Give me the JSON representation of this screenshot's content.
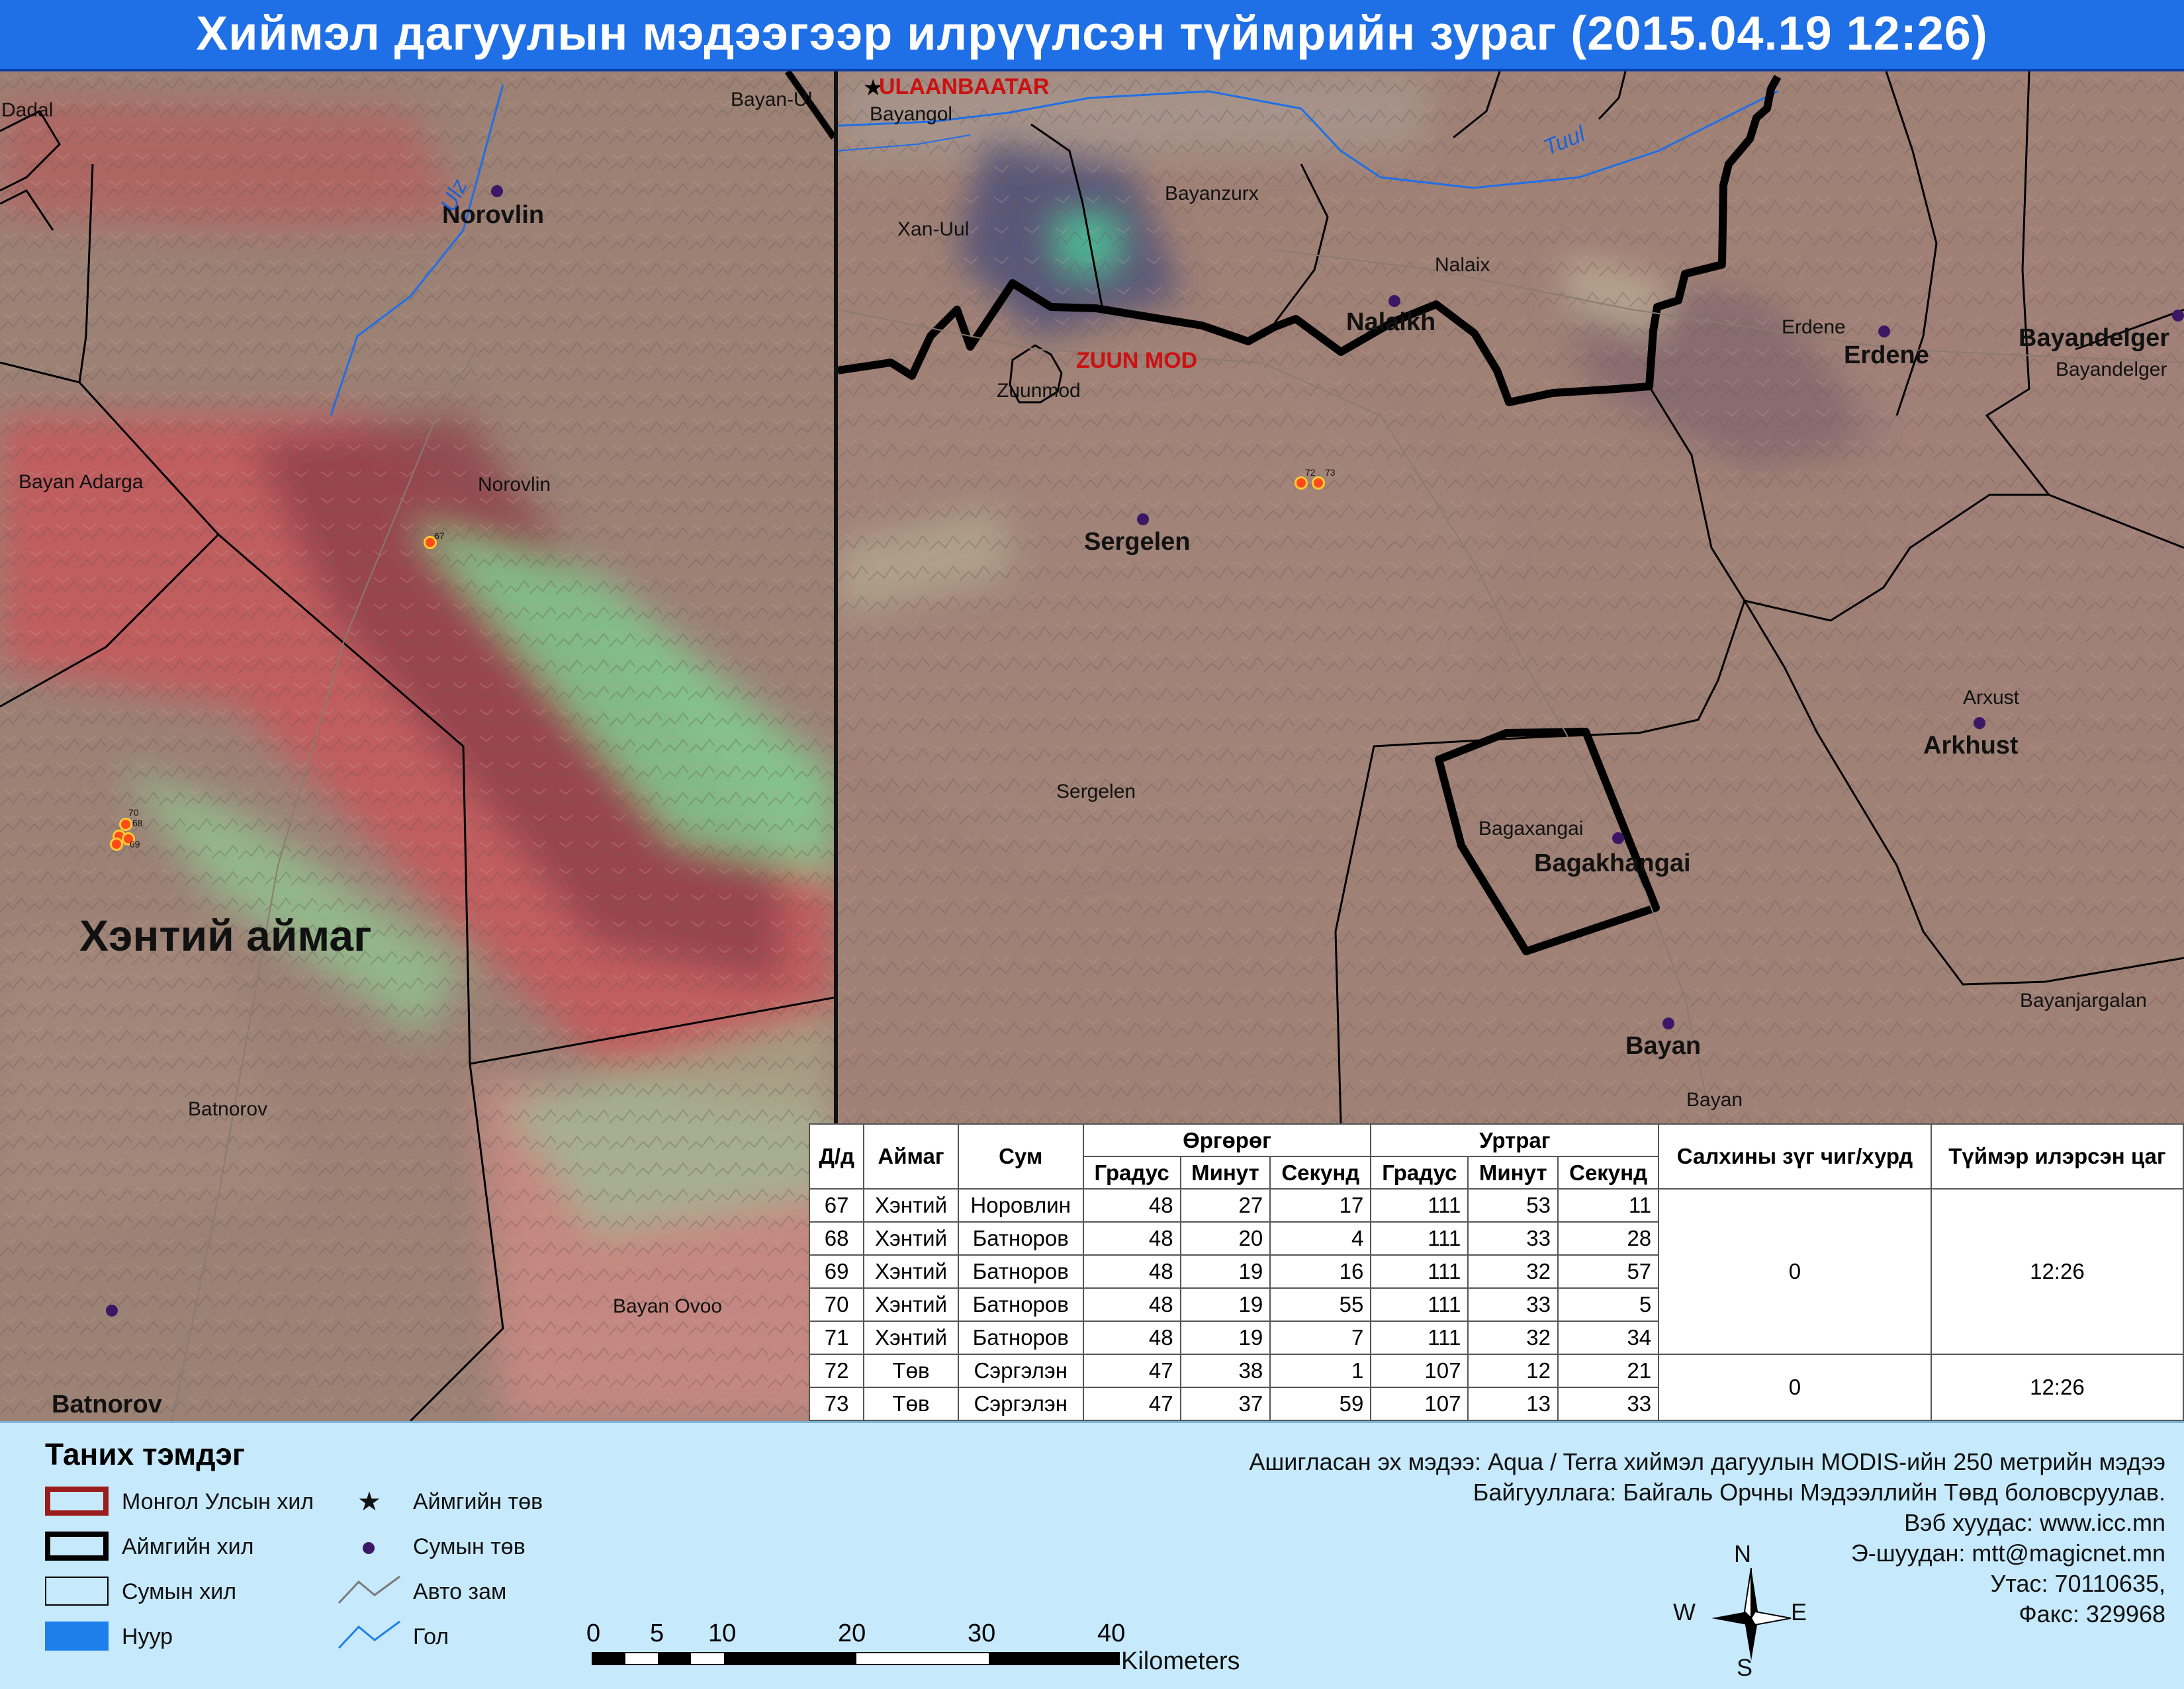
{
  "title": "Хиймэл дагуулын мэдээгээр илрүүлсэн түймрийн зураг  (2015.04.19 12:26)",
  "left_map": {
    "aimag_label": "Хэнтий аймаг",
    "place_labels": [
      "Dadal",
      "Bayan-Ul",
      "Norovlin",
      "Bayan Adarga",
      "Norovlin",
      "Batnorov",
      "Bayan Ovoo",
      "Batnorov"
    ],
    "river_label": "Ulz",
    "fire_labels": [
      "67",
      "70",
      "68",
      "69"
    ]
  },
  "right_map": {
    "capital_label": "ULAANBAATAR",
    "center_label": "ZUUN MOD",
    "river_label": "Tuul",
    "place_labels": [
      "Bayangol",
      "Xan-Uul",
      "Bayanzurx",
      "Nalaix",
      "Nalaikh",
      "Zuunmod",
      "Erdene",
      "Erdene",
      "Bayandelger",
      "Bayandelger",
      "Sergelen",
      "Sergelen",
      "Arxust",
      "Arkhust",
      "Bagaxangai",
      "Bagakhangai",
      "Bayanjargalan",
      "Bayan",
      "Bayan"
    ],
    "fire_labels": [
      "72",
      "73"
    ]
  },
  "table": {
    "headers": {
      "no": "Д/д",
      "aimag": "Аймаг",
      "sum": "Сум",
      "lat": "Өргөрөг",
      "lon": "Уртраг",
      "deg": "Градус",
      "min": "Минут",
      "sec": "Секунд",
      "wind": "Салхины зүг чиг/хурд",
      "time": "Түймэр илэрсэн цаг"
    },
    "rows": [
      {
        "no": "67",
        "aimag": "Хэнтий",
        "sum": "Норовлин",
        "lat_d": "48",
        "lat_m": "27",
        "lat_s": "17",
        "lon_d": "111",
        "lon_m": "53",
        "lon_s": "11"
      },
      {
        "no": "68",
        "aimag": "Хэнтий",
        "sum": "Батноров",
        "lat_d": "48",
        "lat_m": "20",
        "lat_s": "4",
        "lon_d": "111",
        "lon_m": "33",
        "lon_s": "28"
      },
      {
        "no": "69",
        "aimag": "Хэнтий",
        "sum": "Батноров",
        "lat_d": "48",
        "lat_m": "19",
        "lat_s": "16",
        "lon_d": "111",
        "lon_m": "32",
        "lon_s": "57"
      },
      {
        "no": "70",
        "aimag": "Хэнтий",
        "sum": "Батноров",
        "lat_d": "48",
        "lat_m": "19",
        "lat_s": "55",
        "lon_d": "111",
        "lon_m": "33",
        "lon_s": "5"
      },
      {
        "no": "71",
        "aimag": "Хэнтий",
        "sum": "Батноров",
        "lat_d": "48",
        "lat_m": "19",
        "lat_s": "7",
        "lon_d": "111",
        "lon_m": "32",
        "lon_s": "34"
      },
      {
        "no": "72",
        "aimag": "Төв",
        "sum": "Сэргэлэн",
        "lat_d": "47",
        "lat_m": "38",
        "lat_s": "1",
        "lon_d": "107",
        "lon_m": "12",
        "lon_s": "21"
      },
      {
        "no": "73",
        "aimag": "Төв",
        "sum": "Сэргэлэн",
        "lat_d": "47",
        "lat_m": "37",
        "lat_s": "59",
        "lon_d": "107",
        "lon_m": "13",
        "lon_s": "33"
      }
    ],
    "group1": {
      "wind": "0",
      "time": "12:26"
    },
    "group2": {
      "wind": "0",
      "time": "12:26"
    }
  },
  "legend": {
    "title": "Таних тэмдэг",
    "items": {
      "border_country": "Монгол Улсын хил",
      "border_aimag": "Аймгийн хил",
      "border_sum": "Сумын хил",
      "lake": "Нуур",
      "aimag_center": "Аймгийн төв",
      "sum_center": "Сумын төв",
      "road": "Авто зам",
      "river": "Гол"
    },
    "colors": {
      "country_border": "#9b1c1c",
      "lake": "#1f7fea",
      "river": "#1f7fea"
    }
  },
  "scale": {
    "ticks": [
      "0",
      "5",
      "10",
      "20",
      "30",
      "40"
    ],
    "unit": "Kilometers"
  },
  "compass": {
    "n": "N",
    "s": "S",
    "e": "E",
    "w": "W"
  },
  "info": {
    "source": "Ашигласан эх мэдээ: Aqua / Terra хиймэл дагуулын MODIS-ийн 250 метрийн мэдээ",
    "org": "Байгууллага: Байгаль Орчны Мэдээллийн Төвд боловсруулав.",
    "web": "Вэб хуудас: www.icc.mn",
    "email": "Э-шуудан: mtt@magicnet.mn",
    "phone": "Утас: 70110635,",
    "fax": "Факс: 329968"
  }
}
